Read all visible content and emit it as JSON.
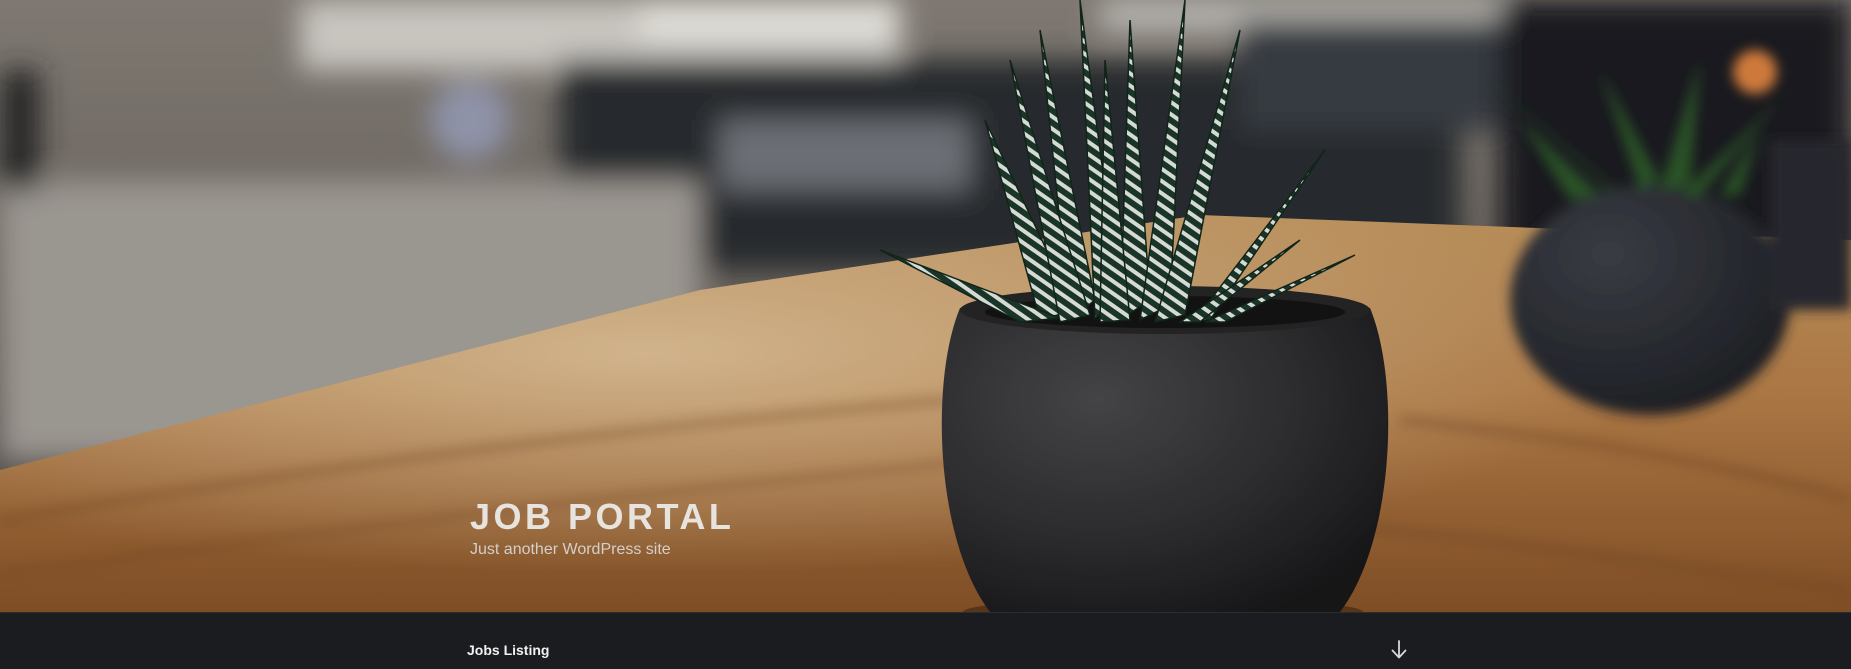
{
  "site": {
    "title": "JOB PORTAL",
    "description": "Just another WordPress site"
  },
  "navigation": {
    "items": [
      {
        "label": "Jobs Listing"
      }
    ],
    "scroll_icon": "arrow-down-icon"
  },
  "colors": {
    "nav_background": "#1b1c1f",
    "title_text": "#e7e3de",
    "nav_text": "#f1f1f1"
  }
}
